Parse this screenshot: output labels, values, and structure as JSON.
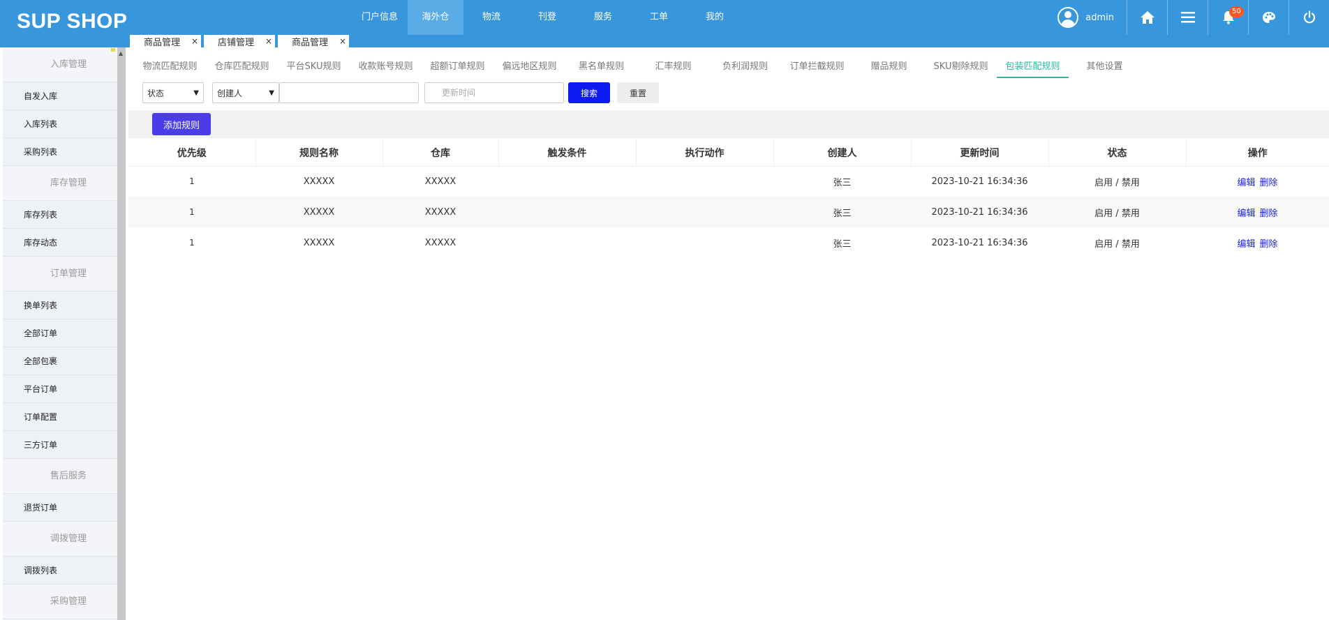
{
  "app": {
    "logo": "SUP SHOP"
  },
  "nav": {
    "items": [
      {
        "label": "门户信息",
        "active": false
      },
      {
        "label": "海外仓",
        "active": true
      },
      {
        "label": "物流",
        "active": false
      },
      {
        "label": "刊登",
        "active": false
      },
      {
        "label": "服务",
        "active": false
      },
      {
        "label": "工单",
        "active": false
      },
      {
        "label": "我的",
        "active": false
      }
    ]
  },
  "user": {
    "name": "admin",
    "notifications": "50"
  },
  "page_tabs": [
    {
      "label": "商品管理"
    },
    {
      "label": "店铺管理"
    },
    {
      "label": "商品管理"
    }
  ],
  "page_tab_close": "×",
  "sidebar": {
    "sections": [
      {
        "title": "入库管理",
        "items": [
          "自发入库",
          "入库列表",
          "采购列表"
        ]
      },
      {
        "title": "库存管理",
        "items": [
          "库存列表",
          "库存动态"
        ]
      },
      {
        "title": "订单管理",
        "items": [
          "换单列表",
          "全部订单",
          "全部包裹",
          "平台订单",
          "订单配置",
          "三方订单"
        ]
      },
      {
        "title": "售后服务",
        "items": [
          "退货订单"
        ]
      },
      {
        "title": "调拨管理",
        "items": [
          "调拨列表"
        ]
      },
      {
        "title": "采购管理",
        "items": []
      }
    ]
  },
  "sub_tabs": [
    {
      "label": "物流匹配规则",
      "active": false
    },
    {
      "label": "仓库匹配规则",
      "active": false
    },
    {
      "label": "平台SKU规则",
      "active": false
    },
    {
      "label": "收款账号规则",
      "active": false
    },
    {
      "label": "超额订单规则",
      "active": false
    },
    {
      "label": "偏远地区规则",
      "active": false
    },
    {
      "label": "黑名单规则",
      "active": false
    },
    {
      "label": "汇率规则",
      "active": false
    },
    {
      "label": "负利润规则",
      "active": false
    },
    {
      "label": "订单拦截规则",
      "active": false
    },
    {
      "label": "赠品规则",
      "active": false
    },
    {
      "label": "SKU剔除规则",
      "active": false
    },
    {
      "label": "包装匹配规则",
      "active": true
    },
    {
      "label": "其他设置",
      "active": false
    }
  ],
  "filters": {
    "status_select": "状态",
    "creator_select": "创建人",
    "keyword_value": "",
    "update_time_placeholder": "更新时间",
    "search_label": "搜索",
    "reset_label": "重置"
  },
  "toolbar": {
    "add_rule_label": "添加规则"
  },
  "table": {
    "columns": [
      "优先级",
      "规则名称",
      "仓库",
      "触发条件",
      "执行动作",
      "创建人",
      "更新时间",
      "状态",
      "操作"
    ],
    "rows": [
      {
        "priority": "1",
        "name": "XXXXX",
        "warehouse": "XXXXX",
        "trigger": "",
        "action": "",
        "creator": "张三",
        "updated": "2023-10-21 16:34:36",
        "status": "启用 / 禁用"
      },
      {
        "priority": "1",
        "name": "XXXXX",
        "warehouse": "XXXXX",
        "trigger": "",
        "action": "",
        "creator": "张三",
        "updated": "2023-10-21 16:34:36",
        "status": "启用 / 禁用"
      },
      {
        "priority": "1",
        "name": "XXXXX",
        "warehouse": "XXXXX",
        "trigger": "",
        "action": "",
        "creator": "张三",
        "updated": "2023-10-21 16:34:36",
        "status": "启用 / 禁用"
      }
    ],
    "edit_label": "编辑",
    "delete_label": "删除"
  },
  "icons": {
    "home": "home-icon",
    "menu": "menu-icon",
    "bell": "bell-icon",
    "palette": "palette-icon",
    "power": "power-icon"
  }
}
